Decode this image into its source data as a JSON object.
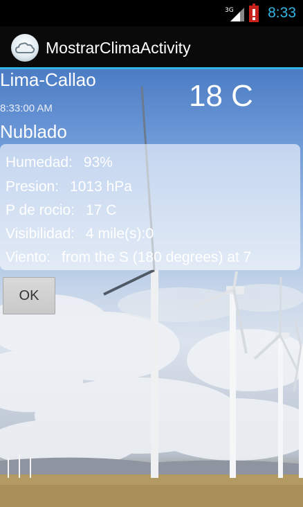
{
  "status_bar": {
    "network": "3G",
    "time": "8:33"
  },
  "action_bar": {
    "title": "MostrarClimaActivity"
  },
  "weather": {
    "city": "Lima-Callao",
    "time": "8:33:00 AM",
    "condition": "Nublado",
    "temperature": "18 C"
  },
  "details": [
    {
      "label": "Humedad:",
      "value": "93%"
    },
    {
      "label": "Presion:",
      "value": "1013 hPa"
    },
    {
      "label": "P de rocio:",
      "value": "17 C"
    },
    {
      "label": "Visibilidad:",
      "value": "4 mile(s):0"
    },
    {
      "label": "Viento:",
      "value": "from the S (180 degrees) at 7"
    }
  ],
  "ok_button": {
    "label": "OK"
  },
  "colors": {
    "accent": "#33b5e5",
    "battery": "#c8201a"
  }
}
